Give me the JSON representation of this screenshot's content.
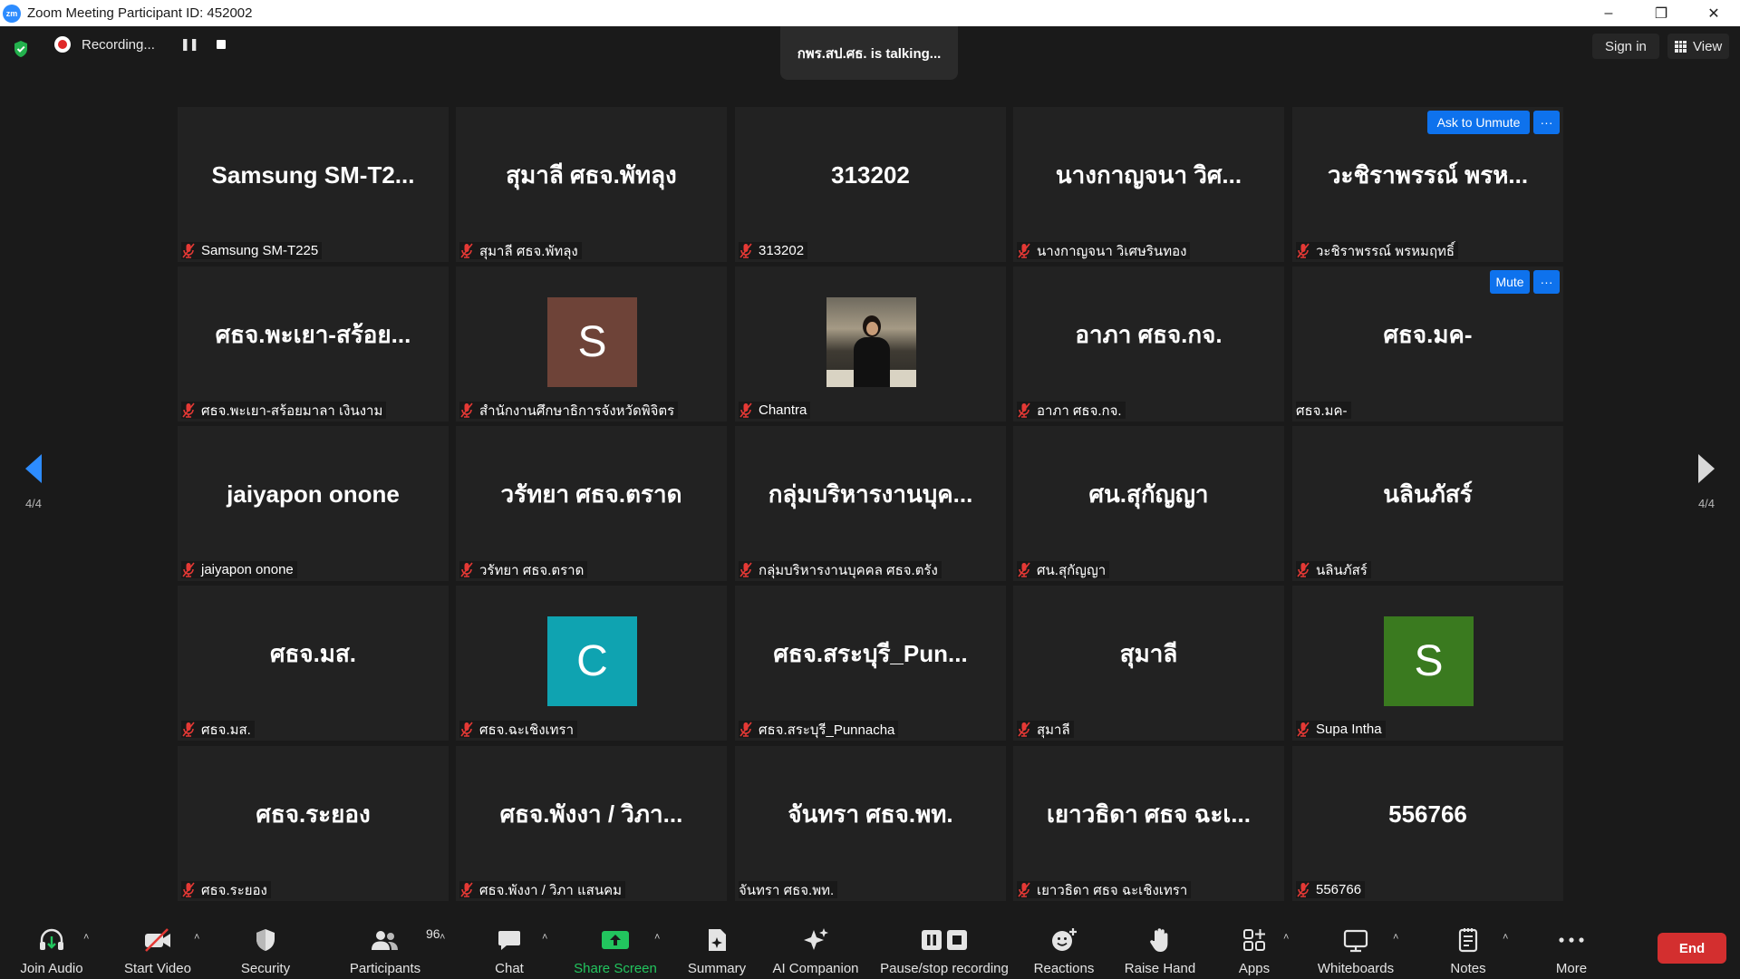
{
  "window": {
    "title": "Zoom Meeting Participant ID: 452002",
    "logo_text": "zm"
  },
  "topbar": {
    "recording_label": "Recording...",
    "talking_label": "กพร.สป.ศธ. is  talking...",
    "sign_in_label": "Sign in",
    "view_label": "View"
  },
  "tiles": [
    {
      "display": "Samsung  SM-T2...",
      "name": "Samsung SM-T225",
      "mic_muted": true
    },
    {
      "display": "สุมาลี ศธจ.พัทลุง",
      "name": "สุมาลี ศธจ.พัทลุง",
      "mic_muted": true
    },
    {
      "display": "313202",
      "name": "313202",
      "mic_muted": true
    },
    {
      "display": "นางกาญจนา  วิศ...",
      "name": "นางกาญจนา  วิเศษรินทอง",
      "mic_muted": true
    },
    {
      "display": "วะชิราพรรณ์ พรห...",
      "name": "วะชิราพรรณ์ พรหมฤทธิ์",
      "mic_muted": true
    },
    {
      "display": "ศธจ.พะเยา-สร้อย...",
      "name": "ศธจ.พะเยา-สร้อยมาลา เงินงาม",
      "mic_muted": true
    },
    {
      "display": "S",
      "name": "สำนักงานศึกษาธิการจังหวัดพิจิตร",
      "mic_muted": true,
      "avatar_color": "#6e4338"
    },
    {
      "display": "",
      "name": "Chantra",
      "mic_muted": true
    },
    {
      "display": "อาภา ศธจ.กจ.",
      "name": "อาภา ศธจ.กจ.",
      "mic_muted": true
    },
    {
      "display": "ศธจ.มค-",
      "name": "ศธจ.มค-",
      "mic_muted": false
    },
    {
      "display": "jaiyapon onone",
      "name": "jaiyapon onone",
      "mic_muted": true
    },
    {
      "display": "วรัทยา ศธจ.ตราด",
      "name": "วรัทยา ศธจ.ตราด",
      "mic_muted": true
    },
    {
      "display": "กลุ่มบริหารงานบุค...",
      "name": "กลุ่มบริหารงานบุคคล ศธจ.ตรัง",
      "mic_muted": true
    },
    {
      "display": "ศน.สุกัญญา",
      "name": "ศน.สุกัญญา",
      "mic_muted": true
    },
    {
      "display": "นลินภัสร์",
      "name": "นลินภัสร์",
      "mic_muted": true
    },
    {
      "display": "ศธจ.มส.",
      "name": "ศธจ.มส.",
      "mic_muted": true
    },
    {
      "display": "C",
      "name": "ศธจ.ฉะเชิงเทรา",
      "mic_muted": true,
      "avatar_color": "#0fa3b1"
    },
    {
      "display": "ศธจ.สระบุรี_Pun...",
      "name": "ศธจ.สระบุรี_Punnacha",
      "mic_muted": true
    },
    {
      "display": "สุมาลี",
      "name": "สุมาลี",
      "mic_muted": true
    },
    {
      "display": "S",
      "name": "Supa Intha",
      "mic_muted": true,
      "avatar_color": "#3a7a1f"
    },
    {
      "display": "ศธจ.ระยอง",
      "name": "ศธจ.ระยอง",
      "mic_muted": true
    },
    {
      "display": "ศธจ.พังงา / วิภา...",
      "name": "ศธจ.พังงา / วิภา แสนคม",
      "mic_muted": true
    },
    {
      "display": "จันทรา ศธจ.พท.",
      "name": "จันทรา ศธจ.พท.",
      "mic_muted": false
    },
    {
      "display": "เยาวธิดา ศธจ ฉะเ...",
      "name": "เยาวธิดา ศธจ ฉะเชิงเทรา",
      "mic_muted": true
    },
    {
      "display": "556766",
      "name": "556766",
      "mic_muted": true
    }
  ],
  "tile_actions": {
    "ask_to_unmute": "Ask to Unmute",
    "mute": "Mute",
    "more": "···"
  },
  "pagination": {
    "left_label": "4/4",
    "right_label": "4/4"
  },
  "toolbar": {
    "join_audio": "Join Audio",
    "start_video": "Start Video",
    "security": "Security",
    "participants": "Participants",
    "participants_count": "96",
    "chat": "Chat",
    "share_screen": "Share Screen",
    "summary": "Summary",
    "ai_companion": "AI Companion",
    "pause_stop_recording": "Pause/stop recording",
    "reactions": "Reactions",
    "raise_hand": "Raise Hand",
    "apps": "Apps",
    "whiteboards": "Whiteboards",
    "notes": "Notes",
    "more": "More",
    "end": "End"
  },
  "colors": {
    "accent_blue": "#0e72ed",
    "share_green": "#22c55e",
    "end_red": "#d32f2f",
    "muted_red": "#e53935"
  }
}
